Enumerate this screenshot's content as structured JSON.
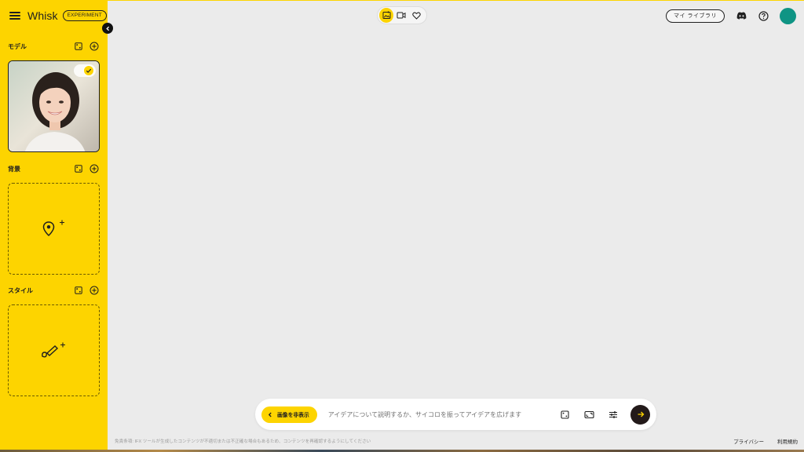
{
  "app": {
    "name": "Whisk",
    "badge": "EXPERIMENT"
  },
  "sidebar": {
    "sections": [
      {
        "title": "モデル",
        "has_image": true
      },
      {
        "title": "背景",
        "has_image": false
      },
      {
        "title": "スタイル",
        "has_image": false
      }
    ]
  },
  "header": {
    "library_label": "マイ ライブラリ"
  },
  "prompt": {
    "hide_images_label": "画像を非表示",
    "placeholder": "アイデアについて説明するか、サイコロを振ってアイデアを広げます"
  },
  "footer": {
    "disclaimer": "免責条項: IFX ツールが生成したコンテンツが不適切または不正確な場合もあるため、コンテンツを再確認するようにしてください",
    "privacy_label": "プライバシー",
    "terms_label": "利用規約"
  },
  "colors": {
    "accent": "#fdd400",
    "avatar": "#0f9484",
    "submit": "#231a1a"
  }
}
